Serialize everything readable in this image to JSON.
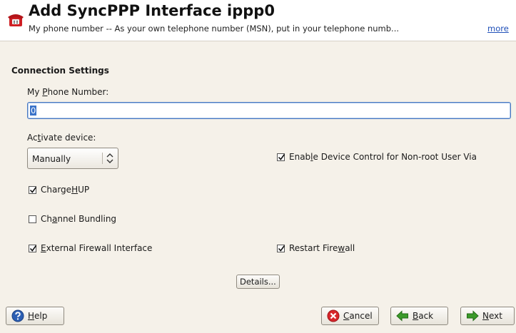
{
  "header": {
    "title": "Add SyncPPP Interface ippp0",
    "help_text": "My phone number -- As your own telephone number (MSN), put in your telephone numb...",
    "more_link": "more",
    "icon": "phone-icon"
  },
  "connection": {
    "section_title": "Connection Settings",
    "phone_label_pre": "My ",
    "phone_label_key": "P",
    "phone_label_post": "hone Number:",
    "phone_value": "0",
    "activate_label_pre": "Ac",
    "activate_label_key": "t",
    "activate_label_post": "ivate device:",
    "activate_value": "Manually",
    "enable_control": {
      "pre": "Enab",
      "key": "l",
      "post": "e Device Control for Non-root User Via",
      "checked": true
    },
    "chargehup": {
      "pre": "Charge",
      "key": "H",
      "post": "UP",
      "checked": true
    },
    "channel_bundling": {
      "pre": "Ch",
      "key": "a",
      "post": "nnel Bundling",
      "checked": false
    },
    "external_firewall": {
      "pre": "",
      "key": "E",
      "post": "xternal Firewall Interface",
      "checked": true
    },
    "restart_firewall": {
      "pre": "Restart Fire",
      "key": "w",
      "post": "all",
      "checked": true
    },
    "details_button": "Details..."
  },
  "footer": {
    "help": {
      "pre": "",
      "key": "H",
      "post": "elp"
    },
    "cancel": {
      "pre": "",
      "key": "C",
      "post": "ancel"
    },
    "back": {
      "pre": "",
      "key": "B",
      "post": "ack"
    },
    "next": {
      "pre": "",
      "key": "N",
      "post": "ext"
    }
  },
  "colors": {
    "link": "#1f4fb8",
    "accent": "#3b73c9",
    "cancel_red": "#d8262b",
    "arrow_green": "#3b9a2a",
    "help_blue": "#2c5fb3"
  }
}
